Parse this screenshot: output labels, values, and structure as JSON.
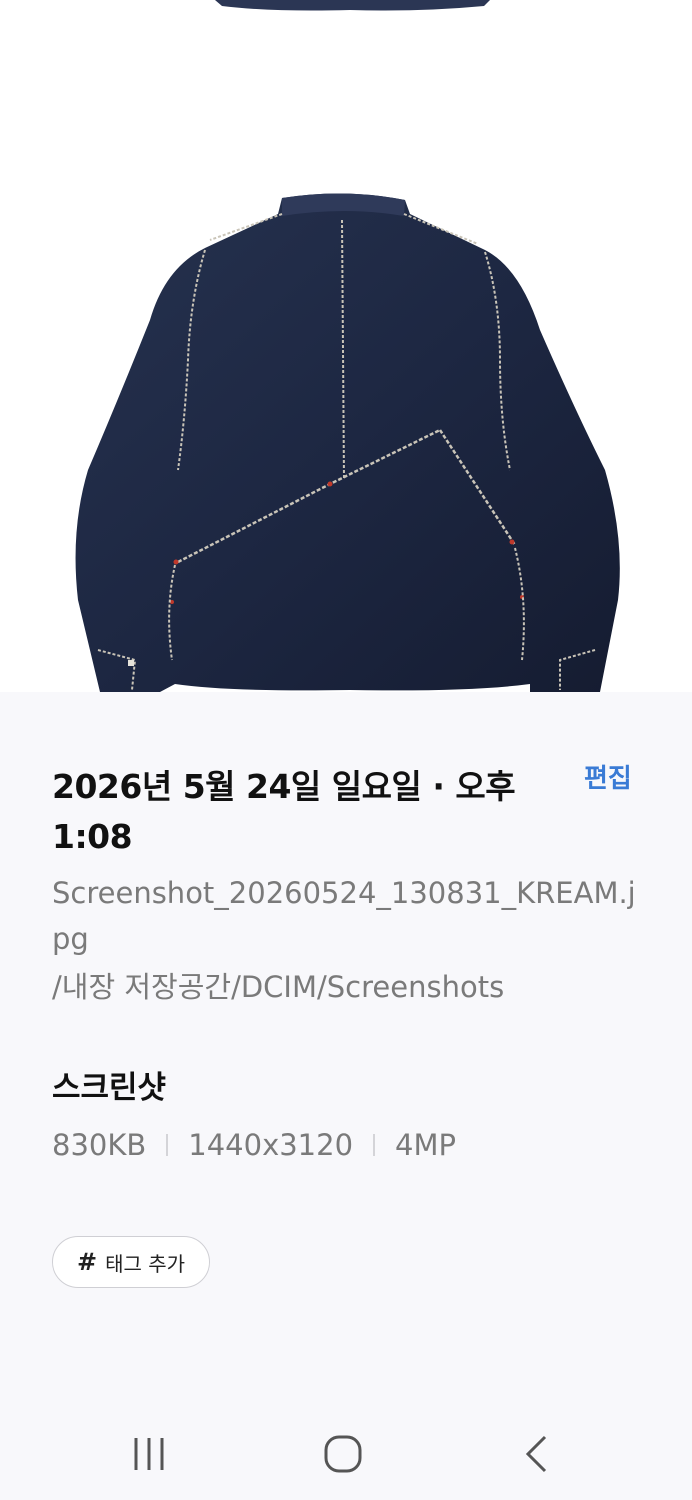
{
  "photo": {
    "subject": "denim-jacket-back",
    "colors": {
      "denim": "#1f2a44",
      "denim_dark": "#141b2e",
      "stitch": "#c9c4b8",
      "background": "#ffffff"
    }
  },
  "details": {
    "date_time": "2026년 5월 24일 일요일 · 오후 1:08",
    "edit_label": "편집",
    "file_name": "Screenshot_20260524_130831_KREAM.jpg",
    "file_path": "/내장 저장공간/DCIM/Screenshots",
    "section_title": "스크린샷",
    "file_size": "830KB",
    "resolution": "1440x3120",
    "megapixels": "4MP",
    "tag_hash": "#",
    "tag_label": "태그 추가",
    "accent_color": "#3a7bd5"
  },
  "navbar": {
    "recents_icon": "recents-icon",
    "home_icon": "home-icon",
    "back_icon": "back-icon"
  }
}
